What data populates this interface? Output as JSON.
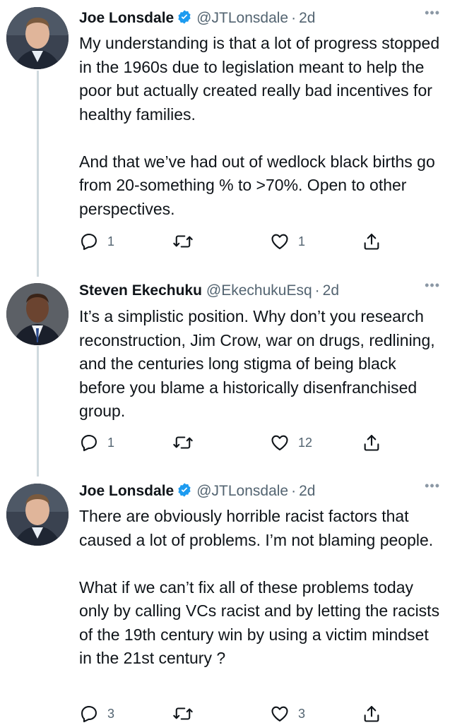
{
  "tweets": [
    {
      "name": "Joe Lonsdale",
      "verified": true,
      "handle": "@JTLonsdale",
      "time": "2d",
      "paragraphs": [
        "My understanding is that a lot of progress stopped in the 1960s due to legislation meant to help the poor but actually created really bad incentives for healthy families.",
        "And that we’ve had out of wedlock black births go from 20-something % to >70%. Open to other perspectives."
      ],
      "replies": "1",
      "retweets": "",
      "likes": "1"
    },
    {
      "name": "Steven Ekechuku",
      "verified": false,
      "handle": "@EkechukuEsq",
      "time": "2d",
      "paragraphs": [
        "It’s a simplistic position. Why don’t you research reconstruction, Jim Crow, war on drugs,  redlining, and the centuries long stigma of being black before you blame a historically disenfranchised group."
      ],
      "replies": "1",
      "retweets": "",
      "likes": "12"
    },
    {
      "name": "Joe Lonsdale",
      "verified": true,
      "handle": "@JTLonsdale",
      "time": "2d",
      "paragraphs": [
        "There are obviously horrible racist factors that caused a lot of problems. I’m not blaming people.",
        "What if we can’t fix all of these problems today only by calling VCs racist and by letting the racists of the 19th century win by using a victim mindset in the 21st century ?"
      ],
      "replies": "3",
      "retweets": "",
      "likes": "3"
    }
  ],
  "separator": "·",
  "more_glyph": "•••",
  "colors": {
    "verified": "#1d9bf0",
    "muted": "#536471",
    "line": "#cfd9de"
  }
}
